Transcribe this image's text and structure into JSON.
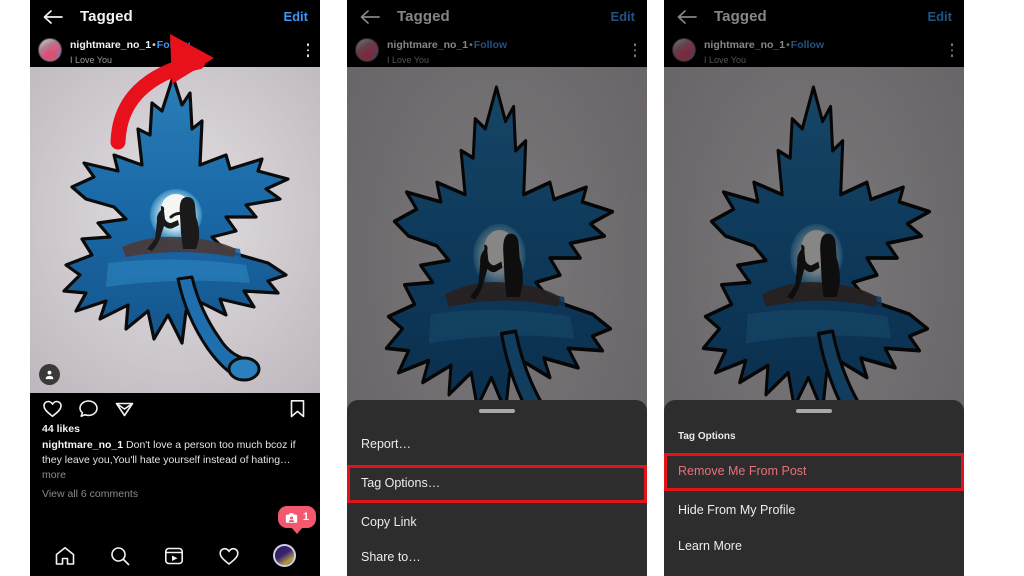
{
  "panels": [
    {
      "id": "panel-post",
      "appbar": {
        "title": "Tagged",
        "edit_label": "Edit",
        "back_icon": "back-arrow-icon"
      },
      "post": {
        "username": "nightmare_no_1",
        "separator": "•",
        "follow_label": "Follow",
        "subtitle": "I Love You",
        "kebab_icon": "more-options-icon",
        "tag_badge_icon": "tagged-people-icon"
      },
      "engagement": {
        "like_icon": "heart-icon",
        "comment_icon": "comment-bubble-icon",
        "share_icon": "share-paperplane-icon",
        "save_icon": "bookmark-icon",
        "likes_text": "44 likes",
        "caption_author": "nightmare_no_1",
        "caption_text": "Don't love a person too much bcoz if they leave  you,You'll hate yourself instead of hating…",
        "more_label": "more",
        "comments_label": "View all 6 comments"
      },
      "notification": {
        "count": "1",
        "icon": "tag-notification-icon"
      },
      "bottom_nav": [
        {
          "name": "home",
          "icon": "home-icon"
        },
        {
          "name": "search",
          "icon": "search-icon"
        },
        {
          "name": "reels",
          "icon": "reels-icon"
        },
        {
          "name": "activity",
          "icon": "heart-icon"
        },
        {
          "name": "profile",
          "icon": "profile-avatar-icon"
        }
      ],
      "annotation": {
        "arrow_color": "#e8111b",
        "icon": "curved-red-arrow-icon"
      }
    },
    {
      "id": "panel-post-menu",
      "appbar": {
        "title": "Tagged",
        "edit_label": "Edit",
        "back_icon": "back-arrow-icon"
      },
      "post": {
        "username": "nightmare_no_1",
        "separator": "•",
        "follow_label": "Follow",
        "subtitle": "I Love You",
        "kebab_icon": "more-options-icon"
      },
      "sheet": {
        "handle_icon": "drag-handle-icon",
        "items": [
          {
            "label": "Report…",
            "highlighted": false,
            "danger": false
          },
          {
            "label": "Tag Options…",
            "highlighted": true,
            "danger": false
          },
          {
            "label": "Copy Link",
            "highlighted": false,
            "danger": false
          },
          {
            "label": "Share to…",
            "highlighted": false,
            "danger": false
          }
        ]
      }
    },
    {
      "id": "panel-tag-options",
      "appbar": {
        "title": "Tagged",
        "edit_label": "Edit",
        "back_icon": "back-arrow-icon"
      },
      "post": {
        "username": "nightmare_no_1",
        "separator": "•",
        "follow_label": "Follow",
        "subtitle": "I Love You",
        "kebab_icon": "more-options-icon"
      },
      "sheet": {
        "handle_icon": "drag-handle-icon",
        "section_title": "Tag Options",
        "items": [
          {
            "label": "Remove Me From Post",
            "highlighted": true,
            "danger": true
          },
          {
            "label": "Hide From My Profile",
            "highlighted": false,
            "danger": false
          },
          {
            "label": "Learn More",
            "highlighted": false,
            "danger": false
          }
        ]
      }
    }
  ],
  "colors": {
    "background": "#ffffff",
    "phone_background": "#000000",
    "sheet_background": "#2d2d2d",
    "accent_blue": "#3f96f0",
    "highlight_red": "#e8111b",
    "danger_text": "#e8717a",
    "notification_pink": "#f4586e",
    "artwork_paper": "#cfc9cd",
    "artwork_blue": "#1f6fae"
  }
}
